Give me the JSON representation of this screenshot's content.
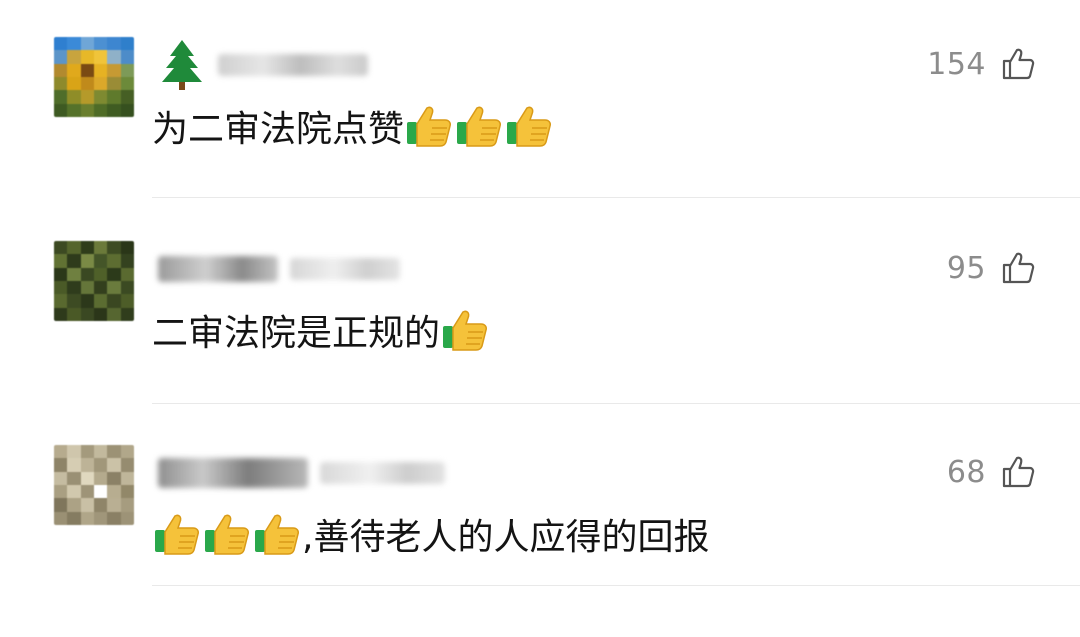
{
  "comments": [
    {
      "likes": "154",
      "text": "为二审法院点赞",
      "emoji_before": 0,
      "emoji_after": 3,
      "avatar": "sunflower-avatar"
    },
    {
      "likes": "95",
      "text": "二审法院是正规的",
      "emoji_before": 0,
      "emoji_after": 1,
      "avatar": "foliage-avatar"
    },
    {
      "likes": "68",
      "text": ",善待老人的人应得的回报",
      "emoji_before": 3,
      "emoji_after": 0,
      "avatar": "cat-avatar"
    }
  ],
  "icons": {
    "like": "thumbs-up-outline-icon",
    "emoji": "thumbs-up-emoji-icon"
  },
  "colors": {
    "like_count": "#8c8c8c",
    "divider": "#e9e9e9"
  }
}
